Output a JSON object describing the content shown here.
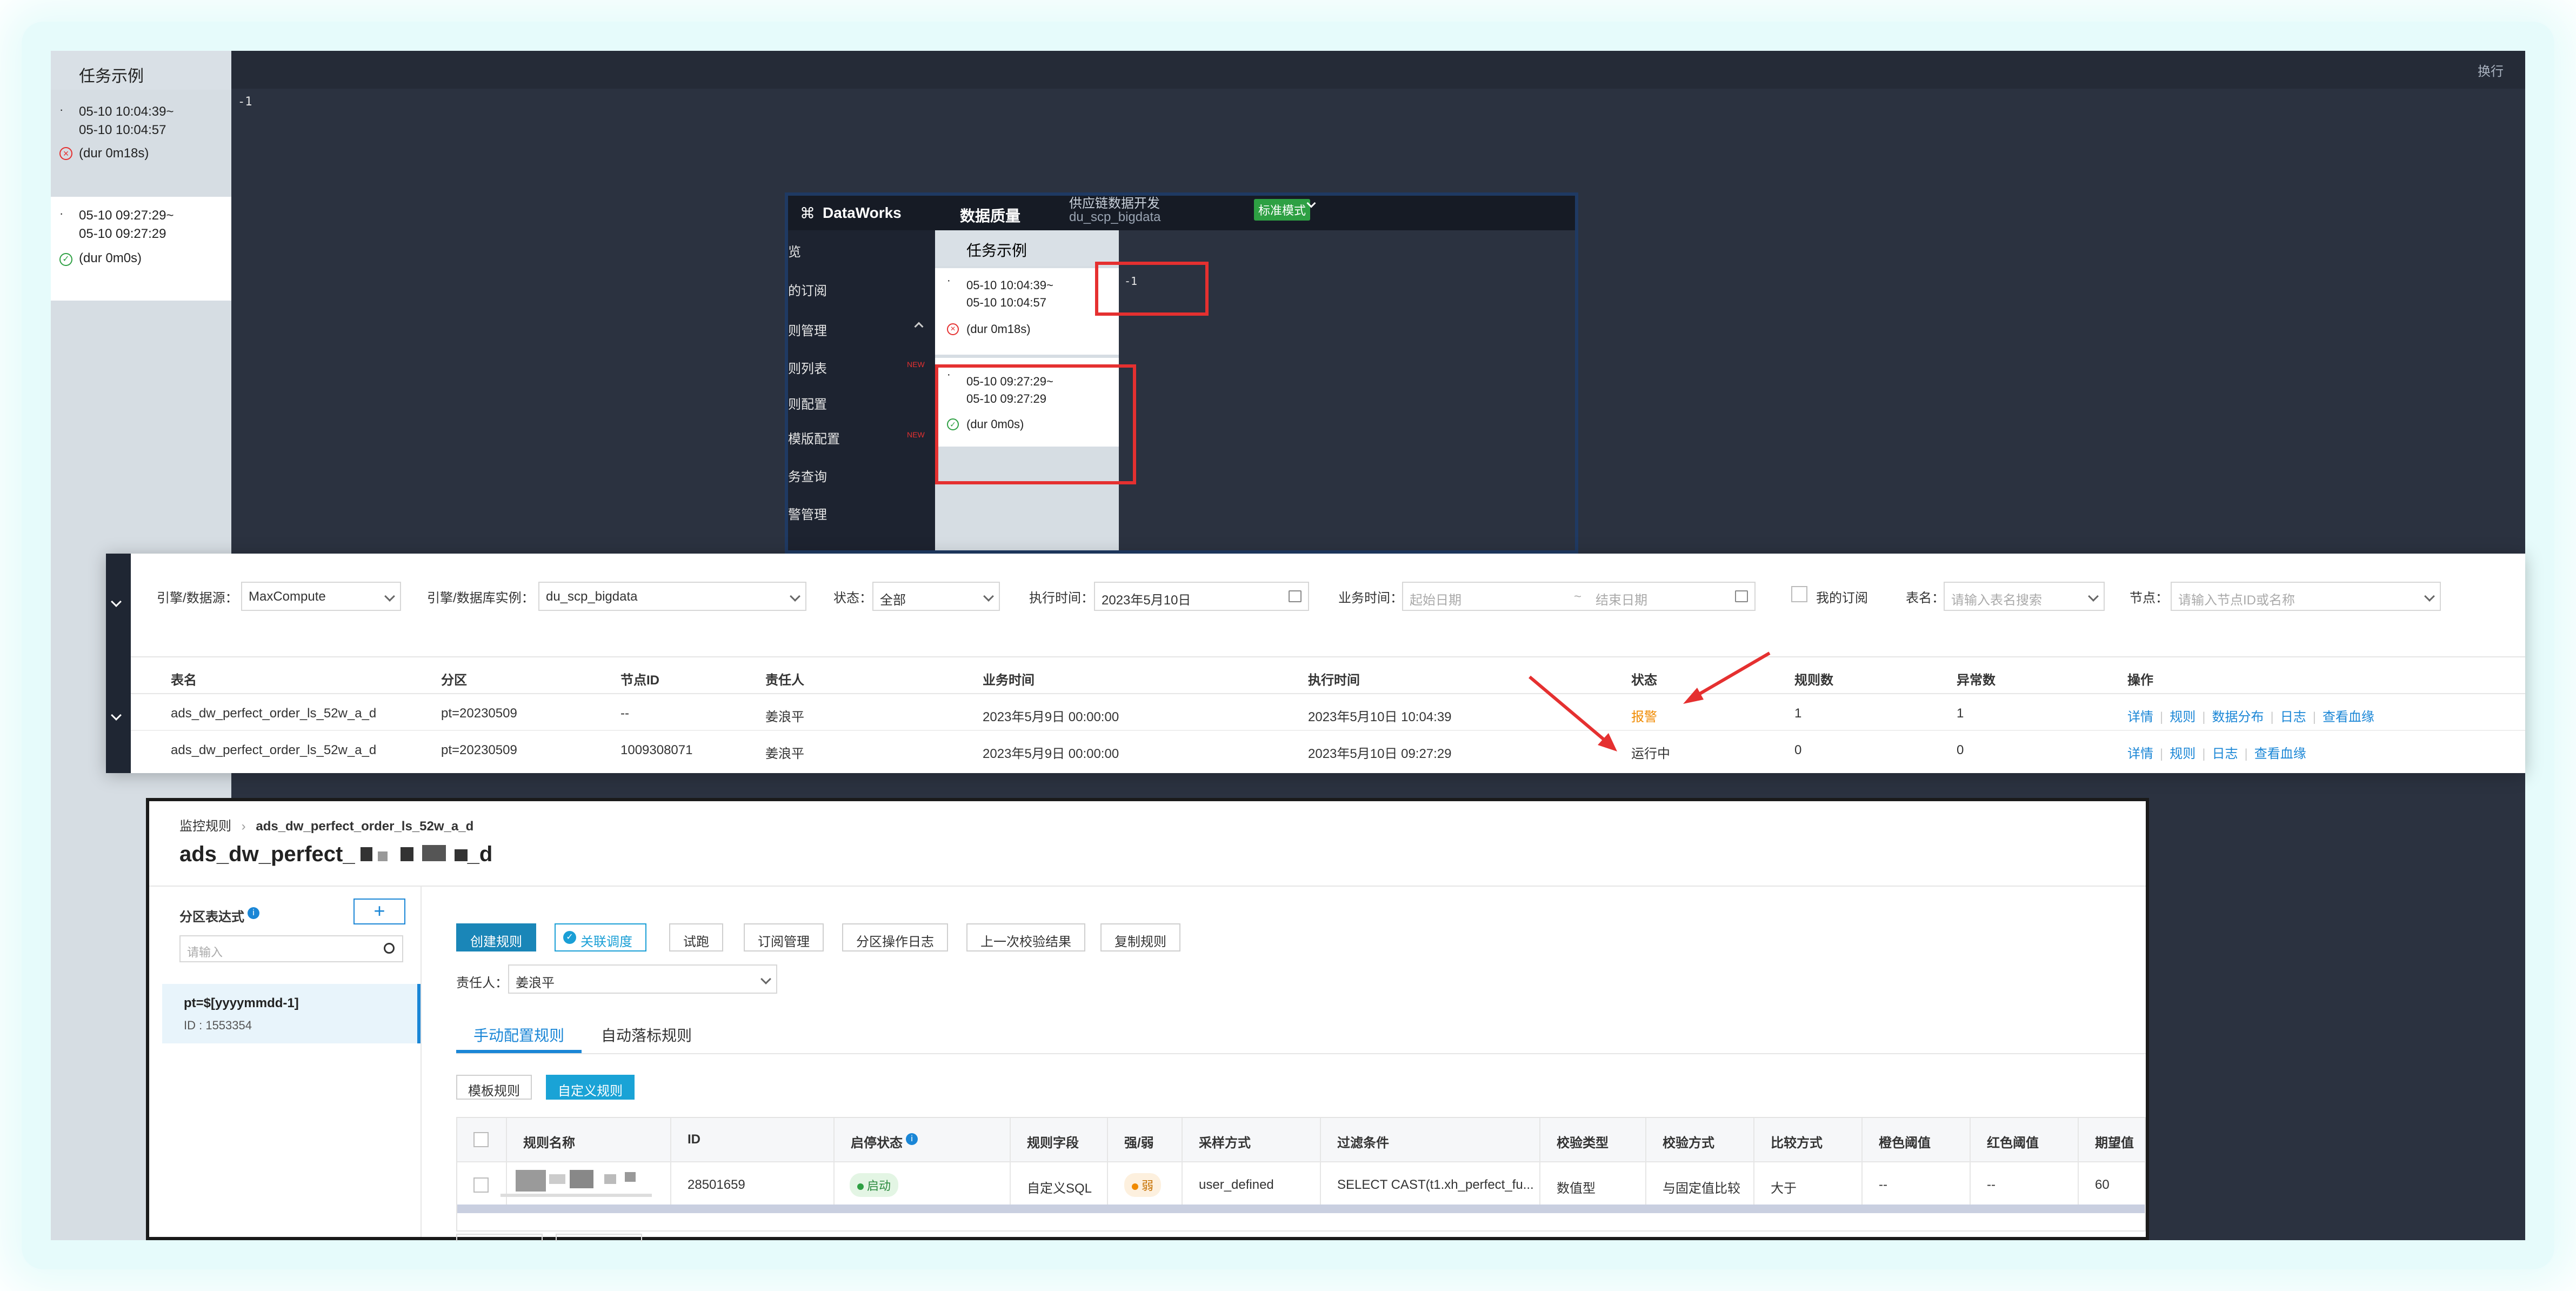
{
  "colors": {
    "accent": "#1a86b8",
    "link": "#1a86d6",
    "warn": "#f08a00",
    "annotation": "#e53030",
    "dark_bg": "#2b3240"
  },
  "background_window": {
    "panel_title": "任务示例",
    "top_right": "换行",
    "code_text": "-1",
    "instances": [
      {
        "time": "05-10 10:04:39~\n05-10 10:04:57",
        "status_icon": "error-circle",
        "duration": "(dur 0m18s)"
      },
      {
        "time": "05-10 09:27:29~\n05-10 09:27:29",
        "status_icon": "success-circle",
        "duration": "(dur 0m0s)"
      }
    ]
  },
  "dataworks_popup": {
    "logo": "DataWorks",
    "module": "数据质量",
    "project_line1": "供应链数据开发",
    "project_line2": "du_scp_bigdata",
    "mode": "标准模式",
    "sidebar": [
      {
        "label": "览",
        "badge": ""
      },
      {
        "label": "的订阅",
        "badge": ""
      },
      {
        "label": "则管理",
        "badge": ""
      },
      {
        "label": "则列表",
        "badge": "NEW"
      },
      {
        "label": "则配置",
        "badge": ""
      },
      {
        "label": "模版配置",
        "badge": "NEW"
      },
      {
        "label": "务查询",
        "badge": ""
      },
      {
        "label": "警管理",
        "badge": ""
      }
    ],
    "panel_title": "任务示例",
    "code_text": "-1",
    "instances": [
      {
        "time": "05-10 10:04:39~\n05-10 10:04:57",
        "duration": "(dur 0m18s)"
      },
      {
        "time": "05-10 09:27:29~\n05-10 09:27:29",
        "duration": "(dur 0m0s)"
      }
    ]
  },
  "filters": {
    "engine_label": "引擎/数据源：",
    "engine_value": "MaxCompute",
    "instance_label": "引擎/数据库实例：",
    "instance_value": "du_scp_bigdata",
    "status_label": "状态：",
    "status_value": "全部",
    "exec_time_label": "执行时间：",
    "exec_time_value": "2023年5月10日",
    "biz_time_label": "业务时间：",
    "biz_start_ph": "起始日期",
    "biz_end_ph": "结束日期",
    "my_sub_label": "我的订阅",
    "table_label": "表名：",
    "table_ph": "请输入表名搜索",
    "node_label": "节点：",
    "node_ph": "请输入节点ID或名称"
  },
  "result_table": {
    "headers": [
      "表名",
      "分区",
      "节点ID",
      "责任人",
      "业务时间",
      "执行时间",
      "状态",
      "规则数",
      "异常数",
      "操作"
    ],
    "rows": [
      {
        "table": "ads_dw_perfect_order_ls_52w_a_d",
        "partition": "pt=20230509",
        "node_id": "--",
        "owner": "姜浪平",
        "biz_time": "2023年5月9日 00:00:00",
        "exec_time": "2023年5月10日 10:04:39",
        "status": "报警",
        "rules": "1",
        "errors": "1",
        "ops": [
          "详情",
          "规则",
          "数据分布",
          "日志",
          "查看血缘"
        ]
      },
      {
        "table": "ads_dw_perfect_order_ls_52w_a_d",
        "partition": "pt=20230509",
        "node_id": "1009308071",
        "owner": "姜浪平",
        "biz_time": "2023年5月9日 00:00:00",
        "exec_time": "2023年5月10日 09:27:29",
        "status": "运行中",
        "rules": "0",
        "errors": "0",
        "ops": [
          "详情",
          "规则",
          "日志",
          "查看血缘"
        ]
      }
    ]
  },
  "detail": {
    "breadcrumb_root": "监控规则",
    "breadcrumb_current": "ads_dw_perfect_order_ls_52w_a_d",
    "title_prefix": "ads_dw_perfect_",
    "title_suffix": "_d",
    "partition_label": "分区表达式",
    "search_ph": "请输入",
    "partition_expr": "pt=$[yyyymmdd-1]",
    "partition_id": "ID : 1553354",
    "buttons": [
      "创建规则",
      "关联调度",
      "试跑",
      "订阅管理",
      "分区操作日志",
      "上一次校验结果",
      "复制规则"
    ],
    "owner_label": "责任人：",
    "owner_value": "姜浪平",
    "tabs": [
      "手动配置规则",
      "自动落标规则"
    ],
    "subtabs": [
      "模板规则",
      "自定义规则"
    ],
    "grid_headers": [
      "规则名称",
      "ID",
      "启停状态",
      "规则字段",
      "强/弱",
      "采样方式",
      "过滤条件",
      "校验类型",
      "校验方式",
      "比较方式",
      "橙色阈值",
      "红色阈值",
      "期望值"
    ],
    "grid_row": {
      "id": "28501659",
      "state": "启动",
      "field": "自定义SQL",
      "strength": "弱",
      "sample": "user_defined",
      "filter": "SELECT CAST(t1.xh_perfect_fu...",
      "check_type": "数值型",
      "check_method": "与固定值比较",
      "compare": "大于",
      "orange": "--",
      "red": "--",
      "expect": "60"
    }
  }
}
